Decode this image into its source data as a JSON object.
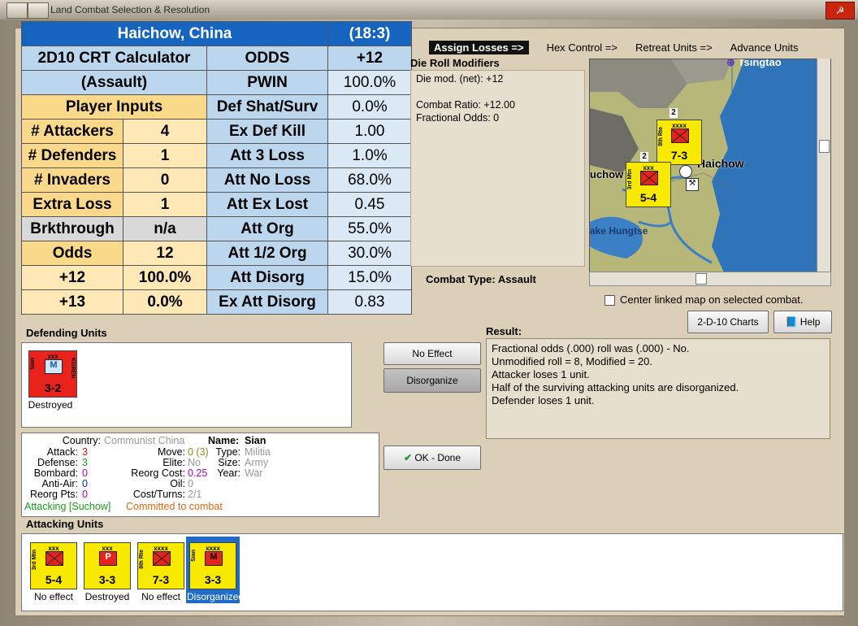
{
  "window": {
    "title": "Land Combat Selection & Resolution"
  },
  "crt": {
    "location": "Haichow, China",
    "coords": "(18:3)",
    "calc_line1": "2D10 CRT Calculator",
    "calc_line2": "(Assault)",
    "player_inputs": "Player Inputs",
    "inputs": [
      {
        "label": "# Attackers",
        "value": "4"
      },
      {
        "label": "# Defenders",
        "value": "1"
      },
      {
        "label": "# Invaders",
        "value": "0"
      },
      {
        "label": "Extra Loss",
        "value": "1"
      },
      {
        "label": "Brkthrough",
        "value": "n/a"
      },
      {
        "label": "Odds",
        "value": "12"
      },
      {
        "label": "+12",
        "value": "100.0%"
      },
      {
        "label": "+13",
        "value": "0.0%"
      }
    ],
    "results": [
      {
        "label": "ODDS",
        "value": "+12"
      },
      {
        "label": "PWIN",
        "value": "100.0%"
      },
      {
        "label": "Def Shat/Surv",
        "value": "0.0%"
      },
      {
        "label": "Ex Def Kill",
        "value": "1.00"
      },
      {
        "label": "Att 3 Loss",
        "value": "1.0%"
      },
      {
        "label": "Att No Loss",
        "value": "68.0%"
      },
      {
        "label": "Att Ex Lost",
        "value": "0.45"
      },
      {
        "label": "Att Org",
        "value": "55.0%"
      },
      {
        "label": "Att 1/2 Org",
        "value": "30.0%"
      },
      {
        "label": "Att Disorg",
        "value": "15.0%"
      },
      {
        "label": "Ex Att Disorg",
        "value": "0.83"
      }
    ]
  },
  "nav": {
    "assign": "Assign Losses =>",
    "hex": "Hex Control =>",
    "retreat": "Retreat Units =>",
    "advance": "Advance Units"
  },
  "drm": {
    "title": "Die Roll Modifiers",
    "net": "Die mod. (net): +12",
    "ratio": "Combat Ratio: +12.00",
    "fractional": "Fractional Odds: 0"
  },
  "combat_type": {
    "label": "Combat Type:",
    "value": "Assault"
  },
  "map": {
    "labels": {
      "tsingtao": "Tsingtao",
      "haichow": "Haichow",
      "suchow": "uchow",
      "lake": "ake Hungtse"
    },
    "units": [
      {
        "size": "xxxx",
        "name": "8th Rte",
        "sf": "7-3",
        "stack": "2"
      },
      {
        "size": "xxx",
        "name": "3rd Mtn",
        "sf": "5-4",
        "stack": "2"
      }
    ],
    "center_label": "Center linked map on selected combat."
  },
  "buttons": {
    "charts": "2-D-10 Charts",
    "help": "Help",
    "no_effect": "No Effect",
    "disorganize": "Disorganize",
    "ok": "OK - Done"
  },
  "result": {
    "title": "Result:",
    "lines": [
      "Fractional odds (.000) roll was (.000)  - No.",
      "Unmodified roll = 8, Modified = 20.",
      "Attacker loses 1 unit.",
      "Half of the surviving attacking units are disorganized.",
      "Defender loses 1 unit."
    ]
  },
  "defending": {
    "title": "Defending Units",
    "units": [
      {
        "size": "xxx",
        "name": "Sian",
        "ext": "KGREN",
        "sym": "M",
        "sf": "3-2",
        "status": "Destroyed",
        "color": "#e8231b"
      }
    ]
  },
  "unit_info": {
    "country_label": "Country:",
    "country": "Communist China",
    "name_label": "Name:",
    "name": "Sian",
    "attack_label": "Attack:",
    "attack": "3",
    "defense_label": "Defense:",
    "defense": "3",
    "bombard_label": "Bombard:",
    "bombard": "0",
    "antiair_label": "Anti-Air:",
    "antiair": "0",
    "reorg_pts_label": "Reorg Pts:",
    "reorg_pts": "0",
    "move_label": "Move:",
    "move": "0 (3)",
    "elite_label": "Elite:",
    "elite": "No",
    "reorg_cost_label": "Reorg Cost:",
    "reorg_cost": "0.25",
    "oil_label": "Oil:",
    "oil": "0",
    "cost_turns_label": "Cost/Turns:",
    "cost_turns": "2/1",
    "type_label": "Type:",
    "type": "Militia",
    "size_label": "Size:",
    "size": "Army",
    "year_label": "Year:",
    "year": "War",
    "attacking_status": "Attacking [Suchow]",
    "committed": "Committed to combat"
  },
  "attacking": {
    "title": "Attacking Units",
    "units": [
      {
        "size": "xxx",
        "name": "3rd Mtn",
        "sym": "",
        "sf": "5-4",
        "status": "No effect",
        "selected": false
      },
      {
        "size": "xxx",
        "name": "",
        "sym": "P",
        "sf": "3-3",
        "status": "Destroyed",
        "selected": false
      },
      {
        "size": "xxxx",
        "name": "8th Rte",
        "sym": "",
        "sf": "7-3",
        "status": "No effect",
        "selected": false
      },
      {
        "size": "xxxx",
        "name": "Sian",
        "sym": "M",
        "sf": "3-3",
        "status": "Disorganized",
        "selected": true
      }
    ]
  },
  "colors": {
    "unit_yellow": "#f7ea00",
    "unit_red": "#e8231b",
    "header_blue": "#1565c0"
  }
}
